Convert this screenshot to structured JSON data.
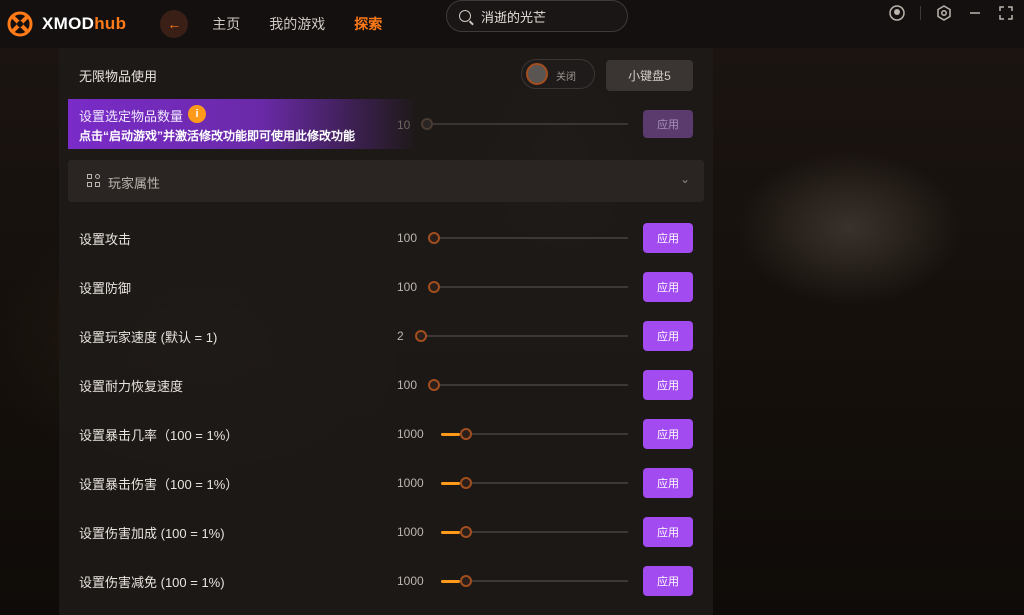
{
  "app": {
    "brand_prefix": "XMOD",
    "brand_suffix": "hub",
    "colors": {
      "accent": "#ff7a18",
      "apply": "#a24bf0",
      "banner": "#7a2bc8"
    }
  },
  "nav": {
    "back_icon": "back-arrow-icon",
    "items": [
      {
        "label": "主页"
      },
      {
        "label": "我的游戏"
      },
      {
        "label": "探索",
        "active": true
      }
    ]
  },
  "search": {
    "value": "消逝的光芒"
  },
  "panel": {
    "unlimited_row": {
      "label": "无限物品使用",
      "toggle_label": "关闭",
      "toggle_on": false,
      "keypad_button": "小键盘5"
    },
    "banner": {
      "title": "设置选定物品数量",
      "message": "点击“启动游戏”并激活修改功能即可使用此修改功能",
      "value": "10",
      "apply_label": "应用"
    },
    "section": {
      "label": "玩家属性"
    },
    "sliders": [
      {
        "label": "设置攻击",
        "value": "100",
        "level": 0.0,
        "apply": "应用"
      },
      {
        "label": "设置防御",
        "value": "100",
        "level": 0.0,
        "apply": "应用"
      },
      {
        "label": "设置玩家速度 (默认 = 1)",
        "value": "2",
        "level": 0.0,
        "apply": "应用"
      },
      {
        "label": "设置耐力恢复速度",
        "value": "100",
        "level": 0.0,
        "apply": "应用"
      },
      {
        "label": "设置暴击几率（100 = 1%）",
        "value": "1000",
        "level": 0.1,
        "apply": "应用"
      },
      {
        "label": "设置暴击伤害（100 = 1%）",
        "value": "1000",
        "level": 0.1,
        "apply": "应用"
      },
      {
        "label": "设置伤害加成 (100 = 1%)",
        "value": "1000",
        "level": 0.1,
        "apply": "应用"
      },
      {
        "label": "设置伤害减免 (100 = 1%)",
        "value": "1000",
        "level": 0.1,
        "apply": "应用"
      }
    ]
  }
}
